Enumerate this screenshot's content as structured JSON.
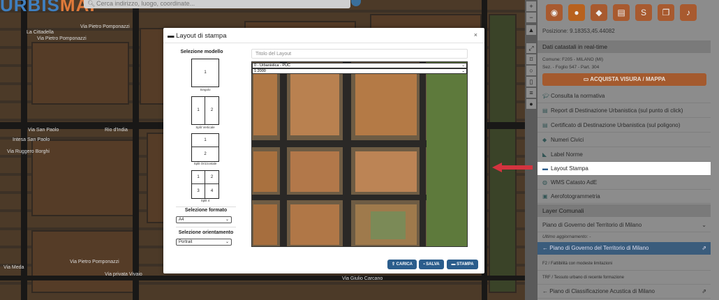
{
  "app": {
    "logo_a": "URBIS",
    "logo_b": "MAP"
  },
  "search": {
    "placeholder": "Cerca indirizzo, luogo, coordinate..."
  },
  "streets": [
    "Via Pietro Pomponazzi",
    "La Cittadella",
    "Via Pietro Pomponazzi",
    "Via San Paolo",
    "Intesa San Paolo",
    "Via Ruggero Borghi",
    "Rio d'India",
    "Via Pietro Pomponazzi",
    "Via Giulio Carcano",
    "Via Meda",
    "Via privata Vivaio"
  ],
  "panel": {
    "position": "Posizione: 9.18353,45.44082",
    "cadastral_section": "Dati catastali in real-time",
    "comune": "Comune: F205 - MILANO (MI)",
    "foglio": "Sez. - Foglio 547 - Part. 304",
    "buy_button": "ACQUISTA VISURA / MAPPA",
    "items": [
      {
        "label": "Consulta la normativa",
        "icon": "graduation-cap-icon"
      },
      {
        "label": "Report di Destinazione Urbanistica (sul punto di click)",
        "icon": "document-icon"
      },
      {
        "label": "Certificato di Destinazione Urbanistica (sul poligono)",
        "icon": "document-icon"
      },
      {
        "label": "Numeri Civici",
        "icon": "diamond-icon"
      },
      {
        "label": "Label Norme",
        "icon": "tag-icon"
      },
      {
        "label": "Layout Stampa",
        "icon": "print-icon"
      },
      {
        "label": "WMS Catasto AdE",
        "icon": "globe-icon"
      },
      {
        "label": "Aerofotogrammetria",
        "icon": "cube-icon"
      }
    ],
    "layer_section": "Layer Comunali",
    "layer_dropdown": "Piano di Governo del Territorio di Milano",
    "last_update": "Ultimo aggiornamento: -",
    "active_layer": "← Piano di Governo del Territorio di Milano",
    "sub1": "F2 / Fattibilità con modeste limitazioni",
    "sub2": "TRF / Tessuto urbano di recente formazione",
    "acoustic_layer": "← Piano di Classificazione Acustica di Milano"
  },
  "modal": {
    "title": "Layout di stampa",
    "close": "×",
    "model_label": "Selezione modello",
    "templates": [
      {
        "caption": "Singolo",
        "cells": [
          "1"
        ]
      },
      {
        "caption": "Split Verticale",
        "cells": [
          "1",
          "2"
        ]
      },
      {
        "caption": "Split Orizzontale",
        "cells": [
          "1",
          "2"
        ]
      },
      {
        "caption": "Split 4",
        "cells": [
          "1",
          "2",
          "3",
          "4"
        ]
      }
    ],
    "format_label": "Selezione formato",
    "format_value": "A4",
    "orientation_label": "Selezione orientamento",
    "orientation_value": "Portrait",
    "title_placeholder": "Titolo del Layout",
    "layer_select": "0 - Urbanistica - PUC",
    "scale_select": "1:2000",
    "buttons": {
      "load": "CARICA",
      "save": "SALVA",
      "print": "STAMPA"
    }
  },
  "colors": {
    "accent": "#b8621e",
    "primary": "#2b5d8c",
    "highlight": "#ffffff",
    "arrow": "#d4333f"
  }
}
